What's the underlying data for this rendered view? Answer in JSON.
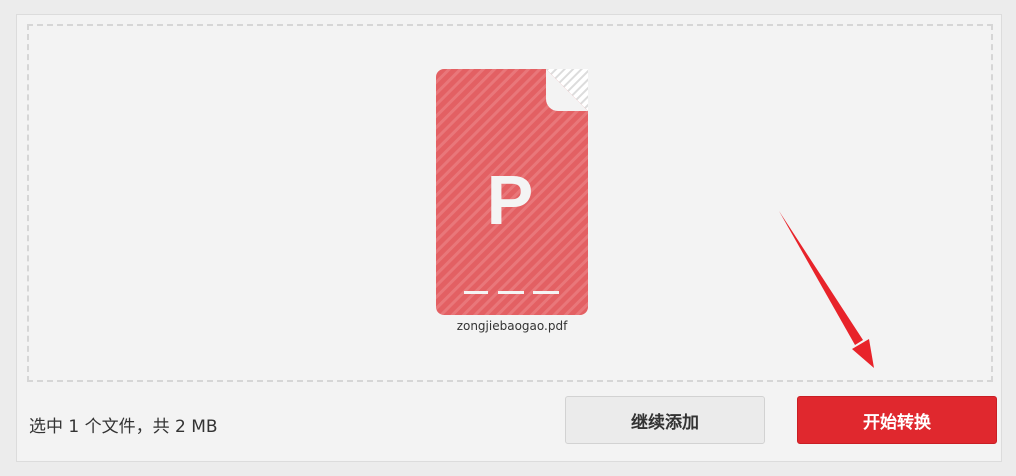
{
  "file": {
    "icon_name": "pdf-file-icon",
    "icon_letter": "P",
    "name": "zongjiebaogao.pdf"
  },
  "status": {
    "summary": "选中 1 个文件，共 2 MB"
  },
  "actions": {
    "continue_label": "继续添加",
    "start_label": "开始转换"
  },
  "annotation": {
    "icon_name": "red-arrow-icon"
  },
  "colors": {
    "file_icon": "#e36063",
    "primary_button": "#e0282e",
    "arrow": "#e8232a"
  }
}
